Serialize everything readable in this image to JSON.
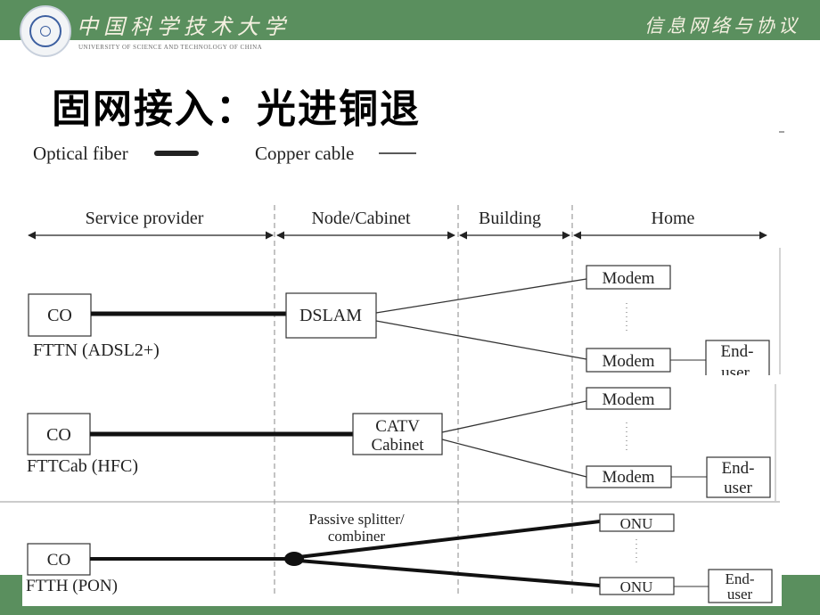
{
  "header": {
    "university_cn": "中国科学技术大学",
    "university_en": "UNIVERSITY OF SCIENCE AND TECHNOLOGY OF CHINA",
    "course": "信息网络与协议",
    "logo": "university-seal-icon"
  },
  "slide": {
    "title": "固网接入：光进铜退"
  },
  "legend": {
    "optical": "Optical fiber",
    "copper": "Copper cable"
  },
  "zones": [
    "Service provider",
    "Node/Cabinet",
    "Building",
    "Home"
  ],
  "rows": [
    {
      "label": "FTTN (ADSL2+)",
      "source": "CO",
      "node": "DSLAM",
      "terminals": [
        "Modem",
        "Modem"
      ],
      "end": "End-user"
    },
    {
      "label": "FTTCab (HFC)",
      "source": "CO",
      "node_lines": [
        "CATV",
        "Cabinet"
      ],
      "terminals": [
        "Modem",
        "Modem"
      ],
      "end_lines": [
        "End-",
        "user"
      ]
    },
    {
      "label": "FTTH (PON)",
      "source": "CO",
      "splitter_lines": [
        "Passive splitter/",
        "combiner"
      ],
      "terminals": [
        "ONU",
        "ONU"
      ],
      "end_lines": [
        "End-",
        "user"
      ]
    }
  ],
  "row1_end_lines": [
    "End-",
    "user"
  ],
  "colors": {
    "brand_green": "#5a8f5e",
    "header_text": "#f4f0e0"
  }
}
